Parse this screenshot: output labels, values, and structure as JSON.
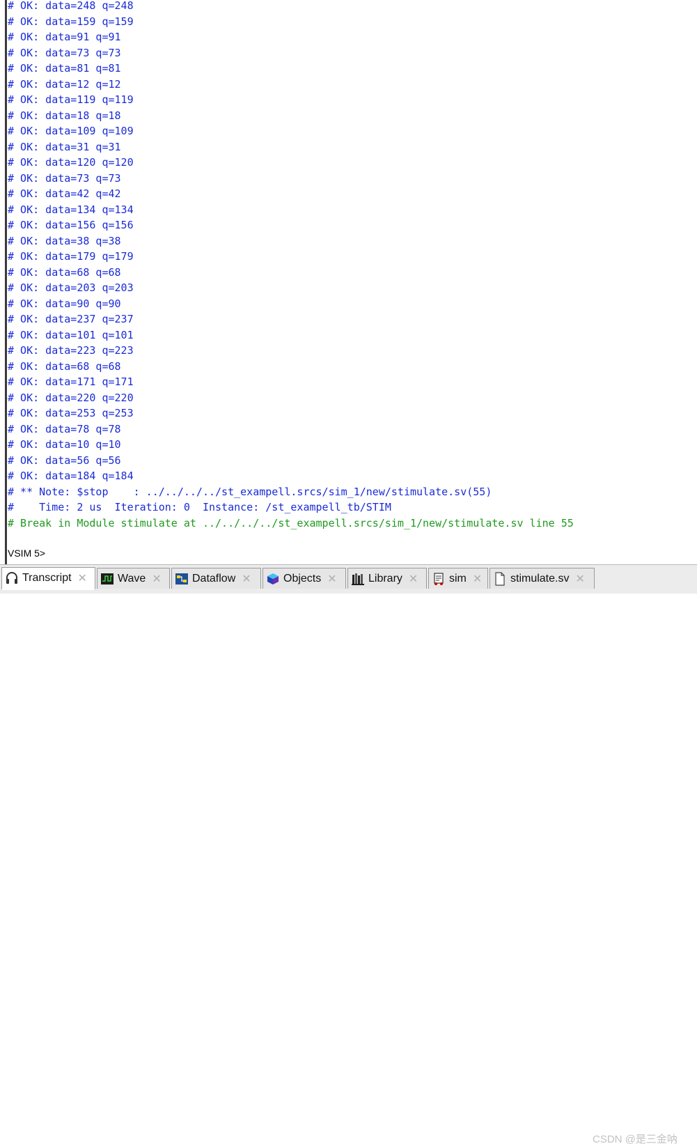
{
  "transcript": {
    "lines": [
      {
        "text": "# OK: data=248 q=248",
        "color": "blue"
      },
      {
        "text": "# OK: data=159 q=159",
        "color": "blue"
      },
      {
        "text": "# OK: data=91 q=91",
        "color": "blue"
      },
      {
        "text": "# OK: data=73 q=73",
        "color": "blue"
      },
      {
        "text": "# OK: data=81 q=81",
        "color": "blue"
      },
      {
        "text": "# OK: data=12 q=12",
        "color": "blue"
      },
      {
        "text": "# OK: data=119 q=119",
        "color": "blue"
      },
      {
        "text": "# OK: data=18 q=18",
        "color": "blue"
      },
      {
        "text": "# OK: data=109 q=109",
        "color": "blue"
      },
      {
        "text": "# OK: data=31 q=31",
        "color": "blue"
      },
      {
        "text": "# OK: data=120 q=120",
        "color": "blue"
      },
      {
        "text": "# OK: data=73 q=73",
        "color": "blue"
      },
      {
        "text": "# OK: data=42 q=42",
        "color": "blue"
      },
      {
        "text": "# OK: data=134 q=134",
        "color": "blue"
      },
      {
        "text": "# OK: data=156 q=156",
        "color": "blue"
      },
      {
        "text": "# OK: data=38 q=38",
        "color": "blue"
      },
      {
        "text": "# OK: data=179 q=179",
        "color": "blue"
      },
      {
        "text": "# OK: data=68 q=68",
        "color": "blue"
      },
      {
        "text": "# OK: data=203 q=203",
        "color": "blue"
      },
      {
        "text": "# OK: data=90 q=90",
        "color": "blue"
      },
      {
        "text": "# OK: data=237 q=237",
        "color": "blue"
      },
      {
        "text": "# OK: data=101 q=101",
        "color": "blue"
      },
      {
        "text": "# OK: data=223 q=223",
        "color": "blue"
      },
      {
        "text": "# OK: data=68 q=68",
        "color": "blue"
      },
      {
        "text": "# OK: data=171 q=171",
        "color": "blue"
      },
      {
        "text": "# OK: data=220 q=220",
        "color": "blue"
      },
      {
        "text": "# OK: data=253 q=253",
        "color": "blue"
      },
      {
        "text": "# OK: data=78 q=78",
        "color": "blue"
      },
      {
        "text": "# OK: data=10 q=10",
        "color": "blue"
      },
      {
        "text": "# OK: data=56 q=56",
        "color": "blue"
      },
      {
        "text": "# OK: data=184 q=184",
        "color": "blue"
      },
      {
        "text": "# ** Note: $stop    : ../../../../st_exampell.srcs/sim_1/new/stimulate.sv(55)",
        "color": "blue"
      },
      {
        "text": "#    Time: 2 us  Iteration: 0  Instance: /st_exampell_tb/STIM",
        "color": "blue"
      },
      {
        "text": "# Break in Module stimulate at ../../../../st_exampell.srcs/sim_1/new/stimulate.sv line 55",
        "color": "green"
      }
    ],
    "prompt": "VSIM 5>"
  },
  "tabs": [
    {
      "label": "Transcript",
      "icon": "headset-icon",
      "active": true
    },
    {
      "label": "Wave",
      "icon": "wave-icon",
      "active": false
    },
    {
      "label": "Dataflow",
      "icon": "dataflow-icon",
      "active": false
    },
    {
      "label": "Objects",
      "icon": "objects-icon",
      "active": false
    },
    {
      "label": "Library",
      "icon": "library-icon",
      "active": false
    },
    {
      "label": "sim",
      "icon": "sim-icon",
      "active": false
    },
    {
      "label": "stimulate.sv",
      "icon": "file-icon",
      "active": false
    }
  ],
  "colors": {
    "blue_text": "#1a2bd6",
    "green_text": "#1f9a1f"
  },
  "watermark": "CSDN @是三金呐"
}
